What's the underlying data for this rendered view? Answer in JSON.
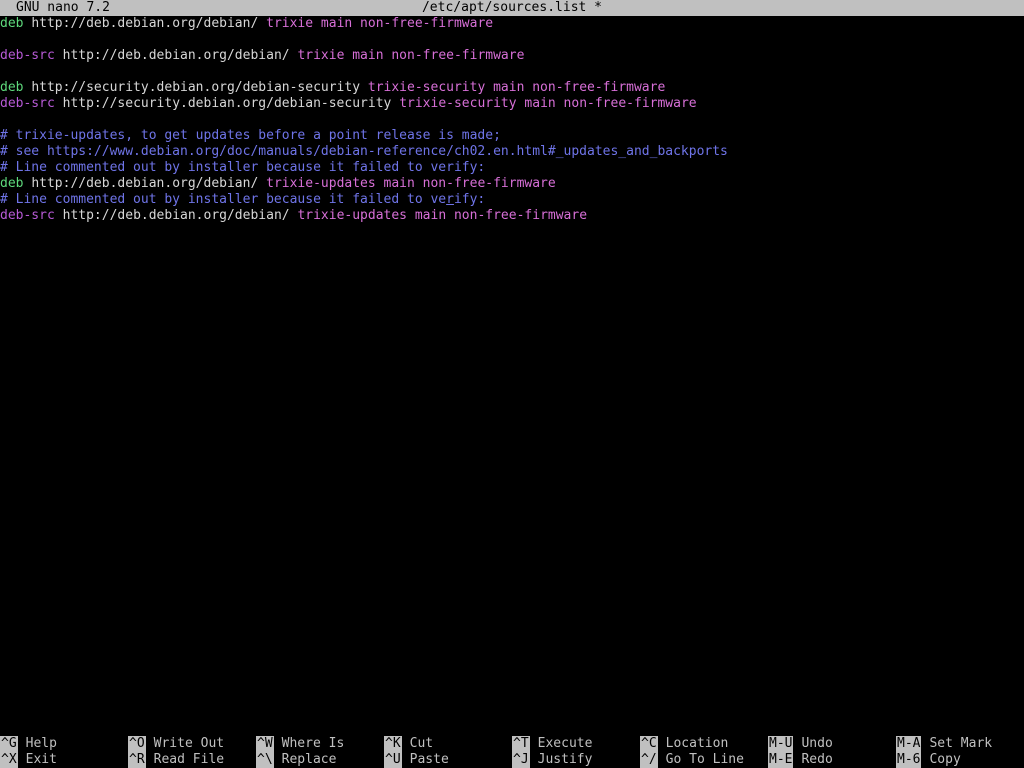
{
  "titlebar": {
    "app": "GNU nano 7.2",
    "file": "/etc/apt/sources.list *"
  },
  "lines": [
    [
      {
        "t": "deb",
        "c": "kw"
      },
      {
        "t": " "
      },
      {
        "t": "http://deb.debian.org/debian/",
        "c": "url"
      },
      {
        "t": " "
      },
      {
        "t": "trixie main non-free-firmware",
        "c": "suite"
      }
    ],
    [],
    [
      {
        "t": "deb-src",
        "c": "kwsrc"
      },
      {
        "t": " "
      },
      {
        "t": "http://deb.debian.org/debian/",
        "c": "url"
      },
      {
        "t": " "
      },
      {
        "t": "trixie main non-free-firmware",
        "c": "suite"
      }
    ],
    [],
    [
      {
        "t": "deb",
        "c": "kw"
      },
      {
        "t": " "
      },
      {
        "t": "http://security.debian.org/debian-security",
        "c": "url"
      },
      {
        "t": " "
      },
      {
        "t": "trixie-security main non-free-firmware",
        "c": "suite"
      }
    ],
    [
      {
        "t": "deb-src",
        "c": "kwsrc"
      },
      {
        "t": " "
      },
      {
        "t": "http://security.debian.org/debian-security",
        "c": "url"
      },
      {
        "t": " "
      },
      {
        "t": "trixie-security main non-free-firmware",
        "c": "suite"
      }
    ],
    [],
    [
      {
        "t": "# trixie-updates, to get updates before a point release is made;",
        "c": "comment"
      }
    ],
    [
      {
        "t": "# see https://www.debian.org/doc/manuals/debian-reference/ch02.en.html#_updates_and_backports",
        "c": "comment"
      }
    ],
    [
      {
        "t": "# Line commented out by installer because it failed to verify:",
        "c": "comment"
      }
    ],
    [
      {
        "t": "deb",
        "c": "kw"
      },
      {
        "t": " "
      },
      {
        "t": "http://deb.debian.org/debian/",
        "c": "url"
      },
      {
        "t": " "
      },
      {
        "t": "trixie-updates main non-free-firmware",
        "c": "suite"
      }
    ],
    [
      {
        "t": "# Line commented out by installer because it failed to ve",
        "c": "comment"
      },
      {
        "t": "r",
        "c": "comment cursor"
      },
      {
        "t": "ify:",
        "c": "comment"
      }
    ],
    [
      {
        "t": "deb-src",
        "c": "kwsrc"
      },
      {
        "t": " "
      },
      {
        "t": "http://deb.debian.org/debian/",
        "c": "url"
      },
      {
        "t": " "
      },
      {
        "t": "trixie-updates main non-free-firmware",
        "c": "suite"
      }
    ]
  ],
  "shortcuts": [
    {
      "key": "^G",
      "label": "Help"
    },
    {
      "key": "^X",
      "label": "Exit"
    },
    {
      "key": "^O",
      "label": "Write Out"
    },
    {
      "key": "^R",
      "label": "Read File"
    },
    {
      "key": "^W",
      "label": "Where Is"
    },
    {
      "key": "^\\",
      "label": "Replace"
    },
    {
      "key": "^K",
      "label": "Cut"
    },
    {
      "key": "^U",
      "label": "Paste"
    },
    {
      "key": "^T",
      "label": "Execute"
    },
    {
      "key": "^J",
      "label": "Justify"
    },
    {
      "key": "^C",
      "label": "Location"
    },
    {
      "key": "^/",
      "label": "Go To Line"
    },
    {
      "key": "M-U",
      "label": "Undo"
    },
    {
      "key": "M-E",
      "label": "Redo"
    },
    {
      "key": "M-A",
      "label": "Set Mark"
    },
    {
      "key": "M-6",
      "label": "Copy"
    }
  ]
}
